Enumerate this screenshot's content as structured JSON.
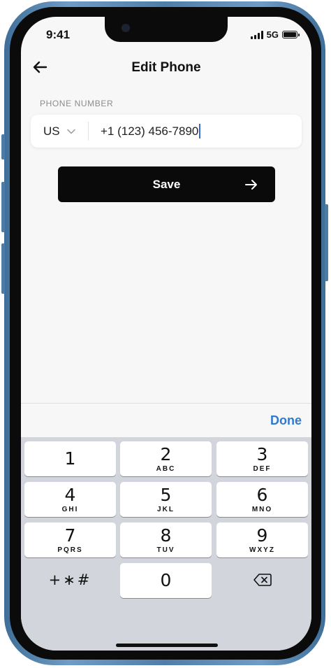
{
  "status_bar": {
    "time": "9:41",
    "network": "5G"
  },
  "nav": {
    "title": "Edit Phone",
    "back_icon": "arrow-left-icon"
  },
  "phone_field": {
    "label": "PHONE NUMBER",
    "country_code": "US",
    "value": "+1 (123) 456-7890",
    "dropdown_icon": "chevron-down-icon"
  },
  "save_button": {
    "label": "Save",
    "icon": "arrow-right-icon",
    "color": "#0a0a0a"
  },
  "accessory": {
    "done_label": "Done",
    "accent_color": "#2f7ad0"
  },
  "keypad": {
    "keys": [
      {
        "digit": "1",
        "letters": ""
      },
      {
        "digit": "2",
        "letters": "ABC"
      },
      {
        "digit": "3",
        "letters": "DEF"
      },
      {
        "digit": "4",
        "letters": "GHI"
      },
      {
        "digit": "5",
        "letters": "JKL"
      },
      {
        "digit": "6",
        "letters": "MNO"
      },
      {
        "digit": "7",
        "letters": "PQRS"
      },
      {
        "digit": "8",
        "letters": "TUV"
      },
      {
        "digit": "9",
        "letters": "WXYZ"
      },
      {
        "digit": "0",
        "letters": ""
      }
    ],
    "symbols_label": "+∗#",
    "delete_icon": "backspace-icon"
  }
}
